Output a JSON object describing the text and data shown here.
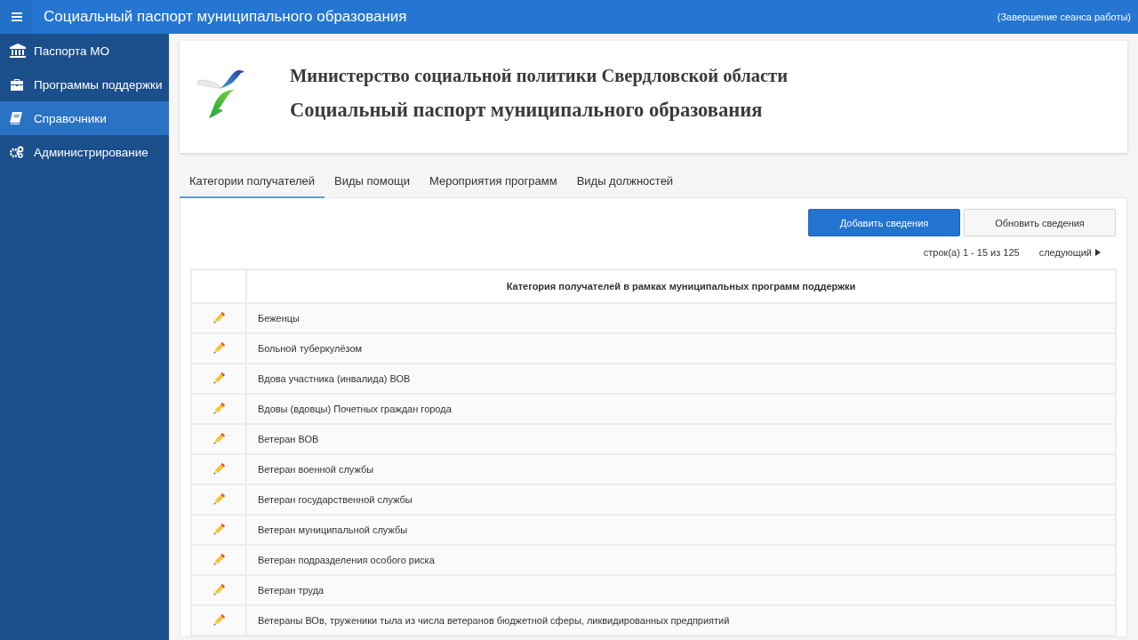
{
  "window": {
    "title": "Социальный паспорт муниципального образования",
    "logout": "(Завершение сеанса работы)"
  },
  "sidebar": {
    "items": [
      {
        "label": "Паспорта МО",
        "selected": false
      },
      {
        "label": "Программы поддержки",
        "selected": false
      },
      {
        "label": "Справочники",
        "selected": true
      },
      {
        "label": "Администрирование",
        "selected": false
      }
    ]
  },
  "header": {
    "ministry": "Министерство социальной политики Свердловской области",
    "title": "Социальный паспорт муниципального образования"
  },
  "tabs": [
    {
      "label": "Категории получателей",
      "selected": true
    },
    {
      "label": "Виды помощи",
      "selected": false
    },
    {
      "label": "Мероприятия программ",
      "selected": false
    },
    {
      "label": "Виды должностей",
      "selected": false
    }
  ],
  "buttons": [
    {
      "label": "Добавить сведения",
      "kind": "primary"
    },
    {
      "label": "Обновить сведения",
      "kind": "default"
    }
  ],
  "pagination": {
    "range": "строк(а) 1 - 15 из 125",
    "next": "следующий"
  },
  "table": {
    "columns": [
      "Категория получателей в рамках муниципальных программ поддержки"
    ],
    "rows": [
      "Беженцы",
      "Больной туберкулёзом",
      "Вдова участника (инвалида) ВОВ",
      "Вдовы (вдовцы) Почетных граждан города",
      "Ветеран ВОВ",
      "Ветеран военной службы",
      "Ветеран государственной службы",
      "Ветеран муниципальной службы",
      "Ветеран подразделения особого риска",
      "Ветеран труда",
      "Ветераны ВОв, труженики тыла из числа ветеранов бюджетной сферы, ликвидированных предприятий"
    ]
  }
}
